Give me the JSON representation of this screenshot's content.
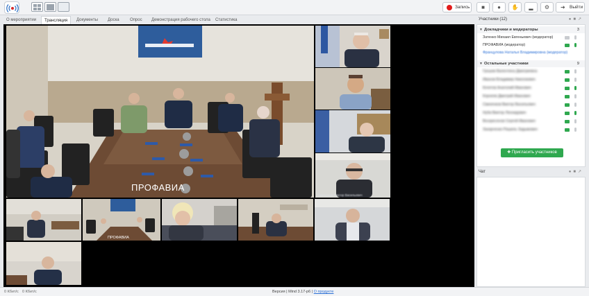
{
  "toolbar": {
    "record_label": "Запись",
    "exit_label": "Выйти"
  },
  "tabs": [
    "О мероприятии",
    "Трансляция",
    "Документы",
    "Доска",
    "Опрос",
    "Демонстрация рабочего стола",
    "Статистика"
  ],
  "participants": {
    "title": "Участники (12)",
    "group1": {
      "label": "Докладчики и модераторы",
      "count": "3"
    },
    "moderators": [
      "Затенко Михаил Евгеньевич (модератор)",
      "ПРОФАВИА (модератор)",
      "Францулова Наталья Владимировна (модератор)"
    ],
    "group2": {
      "label": "Остальные участники",
      "count": "9"
    },
    "others": [
      "Грошев Валентина Дмитриевна",
      "Иванов Владимир Николаевич",
      "Кочетов Анатолий Иванович",
      "Корнеев Дмитрий Иванович",
      "Свиненков Виктор Васильевич",
      "Нуби Виктор Леонидович",
      "Воскресенов Сергей Иванович",
      "Захарченко Рашиль Задымович"
    ],
    "invite_label": "Пригласить участников"
  },
  "chat": {
    "title": "Чат"
  },
  "video": {
    "main_caption": "ПРОФАВИА",
    "banner_text": "профавиа",
    "tile_caption_1": "ПРОФАВИА",
    "tile_caption_2": "Свиненков Виктор Васильевич"
  },
  "status": {
    "left1": "0 Кбит/с",
    "left2": "0 Кбит/с",
    "version": "Версия | Mind 3.17-p6 | ",
    "about": "О продукте"
  },
  "colors": {
    "green": "#2fa84f",
    "red": "#e21b1b",
    "accent_blue": "#2a6fd6"
  }
}
